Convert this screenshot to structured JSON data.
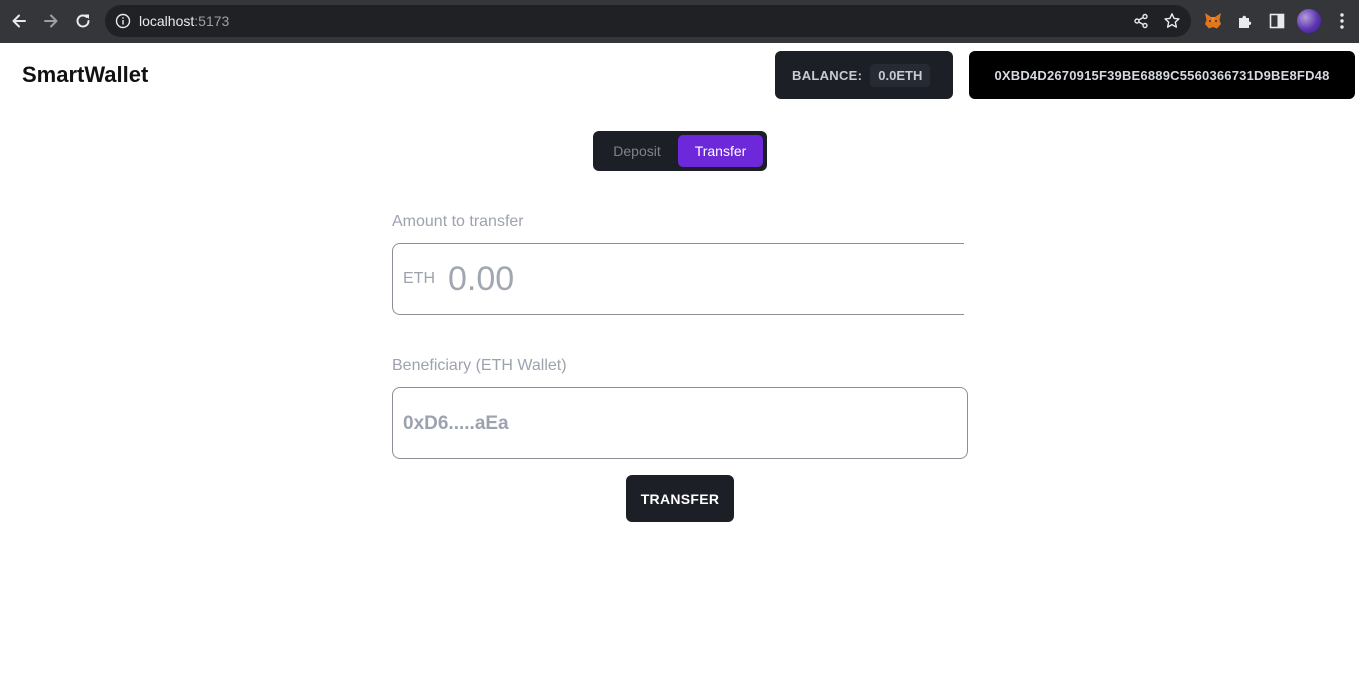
{
  "browser": {
    "url_host": "localhost",
    "url_port": ":5173",
    "icons": [
      "back-icon",
      "forward-icon",
      "reload-icon",
      "info-icon",
      "share-icon",
      "star-icon",
      "metamask-fox-icon",
      "puzzle-extensions-icon",
      "side-panel-icon",
      "profile-avatar",
      "more-vert-icon"
    ]
  },
  "header": {
    "logo": "SmartWallet",
    "balance_label": "BALANCE:",
    "balance_value": "0.0ETH",
    "address": "0XBD4D2670915F39BE6889C5560366731D9BE8FD48"
  },
  "tabs": [
    {
      "label": "Deposit",
      "active": false
    },
    {
      "label": "Transfer",
      "active": true
    }
  ],
  "form": {
    "amount_label": "Amount to transfer",
    "amount_unit": "ETH",
    "amount_placeholder": "0.00",
    "beneficiary_label": "Beneficiary (ETH Wallet)",
    "beneficiary_placeholder": "0xD6.....aEa",
    "submit_label": "TRANSFER"
  },
  "colors": {
    "accent": "#6d28d9",
    "dark_panel": "#1c1f26",
    "chrome_bar": "#35363a"
  }
}
